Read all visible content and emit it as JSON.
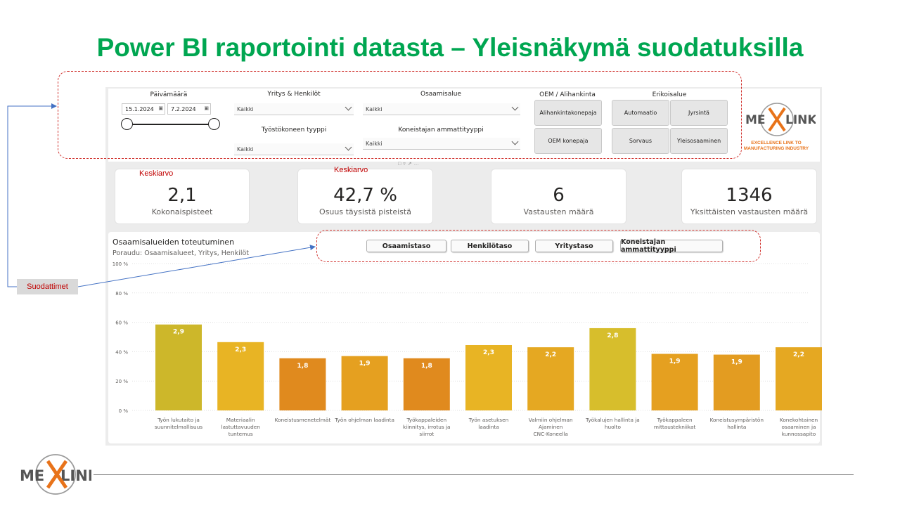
{
  "slide": {
    "title": "Power BI raportointi datasta – Yleisnäkymä suodatuksilla",
    "annotation_avg_1": "Keskiarvo",
    "annotation_avg_2": "Keskiarvo",
    "filter_label": "Suodattimet"
  },
  "filters": {
    "date": {
      "title": "Päivämäärä",
      "start": "15.1.2024",
      "end": "7.2.2024",
      "range_fraction": [
        0,
        1
      ]
    },
    "company": {
      "title": "Yritys & Henkilöt",
      "value": "Kaikki"
    },
    "machine_type": {
      "title": "Työstökoneen tyyppi",
      "value": "Kaikki"
    },
    "competence_area": {
      "title": "Osaamisalue",
      "value": "Kaikki"
    },
    "operator_profession": {
      "title": "Koneistajan ammattityyppi",
      "value": "Kaikki"
    },
    "oem": {
      "title": "OEM / Alihankinta",
      "buttons": [
        "Alihankintakonepaja",
        "OEM konepaja"
      ]
    },
    "specialty": {
      "title": "Erikoisalue",
      "buttons": [
        "Automaatio",
        "Jyrsintä",
        "Sorvaus",
        "Yleisosaaminen"
      ]
    }
  },
  "logo": {
    "text_left": "ME",
    "text_right": "LINK",
    "tagline_1": "EXCELLENCE LINK TO",
    "tagline_2": "MANUFACTURING INDUSTRY",
    "colors": {
      "x": "#e8731a",
      "text": "#555555"
    }
  },
  "kpis": [
    {
      "value": "2,1",
      "label": "Kokonaispisteet"
    },
    {
      "value": "42,7 %",
      "label": "Osuus täysistä pisteistä"
    },
    {
      "value": "6",
      "label": "Vastausten määrä"
    },
    {
      "value": "1346",
      "label": "Yksittäisten vastausten määrä"
    }
  ],
  "chart_panel": {
    "title": "Osaamisalueiden toteutuminen",
    "subtitle": "Poraudu: Osaamisalueet, Yritys, Henkilöt",
    "level_buttons": [
      "Osaamistaso",
      "Henkilötaso",
      "Yritystaso",
      "Koneistajan ammattityyppi"
    ]
  },
  "chart_data": {
    "type": "bar",
    "categories": [
      [
        "Työn lukutaito ja",
        "suunnitelmallisuus"
      ],
      [
        "Materiaalin",
        "lastuttavuuden",
        "tuntemus"
      ],
      [
        "Koneistusmenetelmät"
      ],
      [
        "Työn ohjelman laadinta"
      ],
      [
        "Työkappaleiden",
        "kiinnitys, irrotus ja",
        "siirrot"
      ],
      [
        "Työn asetuksen",
        "laadinta"
      ],
      [
        "Valmiin ohjelman",
        "Ajaminen",
        "CNC-Koneella"
      ],
      [
        "Työkalujen hallinta ja",
        "huolto"
      ],
      [
        "Työkappaleen",
        "mittaustekniikat"
      ],
      [
        "Koneistusympäristön",
        "hallinta"
      ],
      [
        "Konekohtainen",
        "osaaminen ja",
        "kunnossapito"
      ]
    ],
    "values": [
      58.5,
      46.5,
      35.5,
      37,
      35.5,
      44.5,
      43,
      56,
      38.5,
      38,
      43
    ],
    "data_labels": [
      "2,9",
      "2,3",
      "1,8",
      "1,9",
      "1,8",
      "2,3",
      "2,2",
      "2,8",
      "1,9",
      "1,9",
      "2,2"
    ],
    "colors": [
      "#cdb72a",
      "#e8b424",
      "#e08a1e",
      "#e5a020",
      "#e08a1e",
      "#e8b424",
      "#e5a822",
      "#d7be2c",
      "#e5a020",
      "#e39c21",
      "#e5a822"
    ],
    "y_ticks": [
      "0 %",
      "20 %",
      "40 %",
      "60 %",
      "80 %",
      "100 %"
    ],
    "ylim": [
      0,
      100
    ],
    "grid": true
  }
}
